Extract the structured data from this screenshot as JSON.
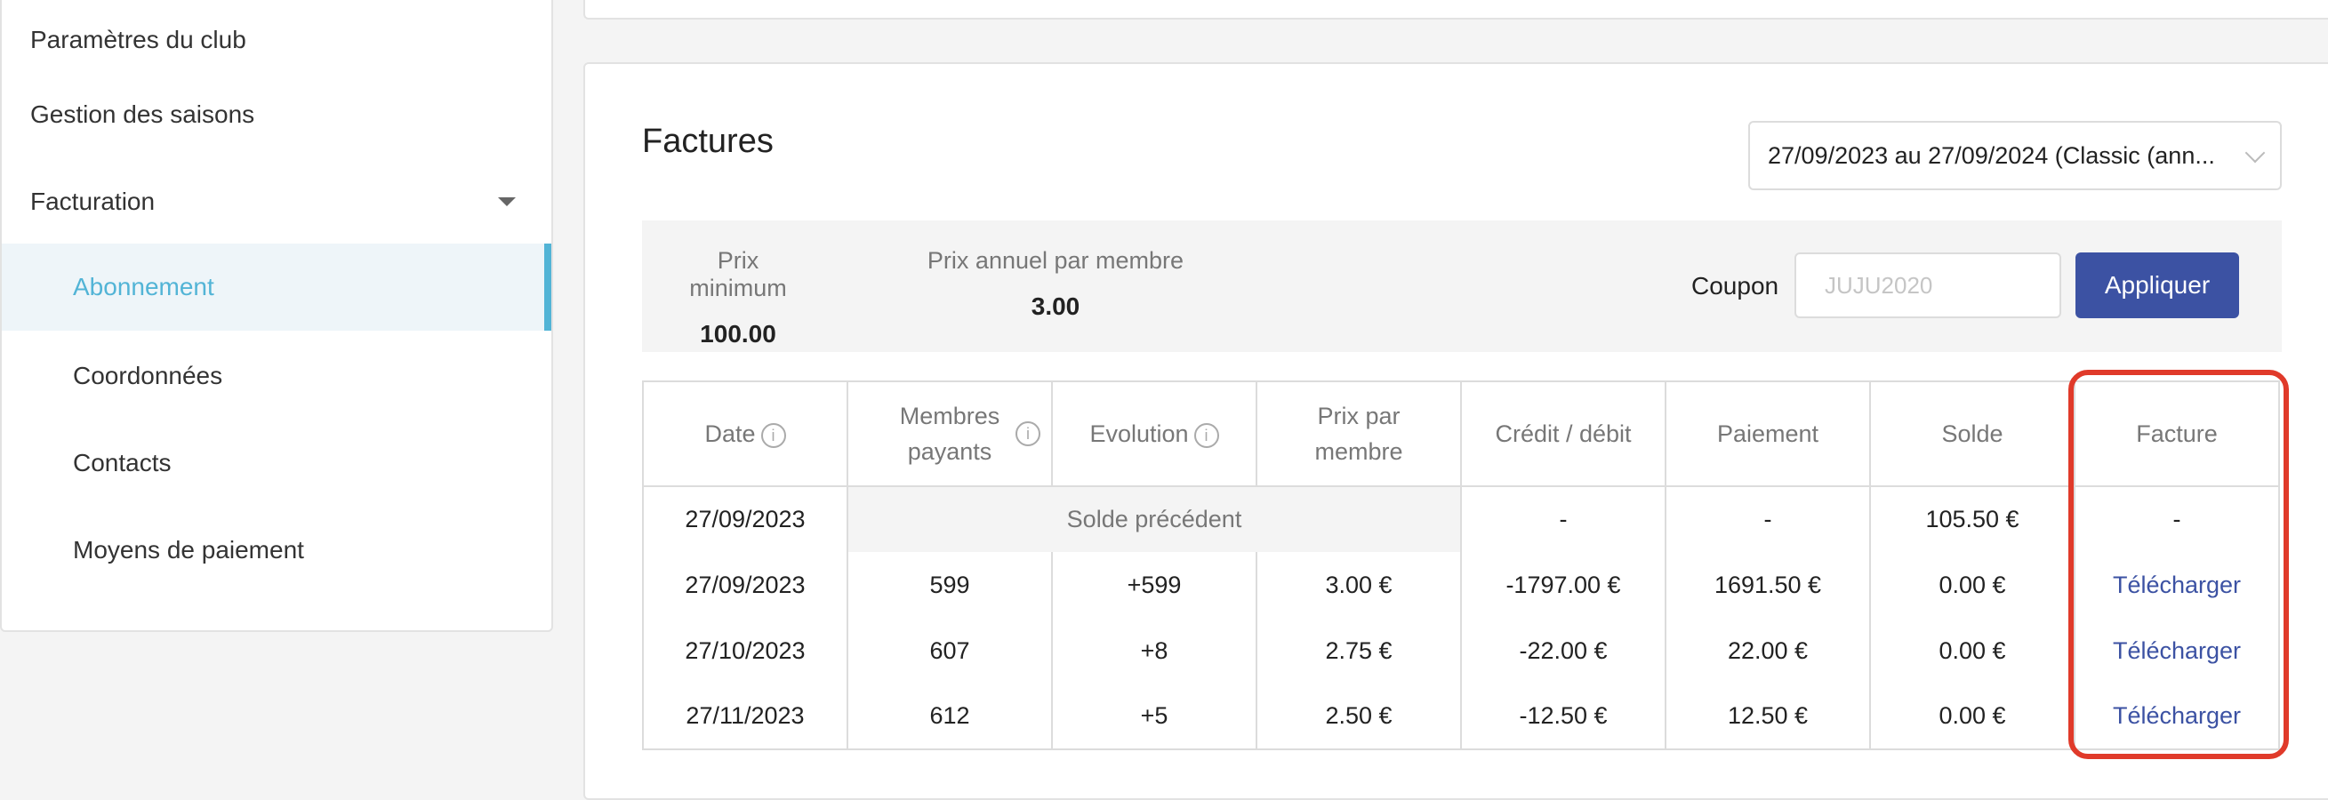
{
  "sidebar": {
    "items": [
      {
        "label": "Paramètres du club"
      },
      {
        "label": "Gestion des saisons"
      },
      {
        "label": "Facturation"
      },
      {
        "label": "Abonnement"
      },
      {
        "label": "Coordonnées"
      },
      {
        "label": "Contacts"
      },
      {
        "label": "Moyens de paiement"
      }
    ]
  },
  "invoices": {
    "title": "Factures",
    "period_select": {
      "value": "27/09/2023 au 27/09/2024 (Classic (ann..."
    },
    "summary": {
      "min_price": {
        "label": "Prix minimum",
        "value": "100.00"
      },
      "annual_price": {
        "label": "Prix annuel par membre",
        "value": "3.00"
      }
    },
    "coupon": {
      "label": "Coupon",
      "placeholder": "JUJU2020",
      "apply_label": "Appliquer"
    },
    "table": {
      "headers": {
        "date": "Date",
        "members_1": "Membres",
        "members_2": "payants",
        "evolution": "Evolution",
        "price_1": "Prix par",
        "price_2": "membre",
        "credit": "Crédit / débit",
        "payment": "Paiement",
        "balance": "Solde",
        "invoice": "Facture"
      },
      "previous_row": {
        "date": "27/09/2023",
        "label": "Solde précédent",
        "credit": "-",
        "payment": "-",
        "balance": "105.50 €",
        "invoice": "-"
      },
      "rows": [
        {
          "date": "27/09/2023",
          "members": "599",
          "evolution": "+599",
          "price": "3.00 €",
          "credit": "-1797.00 €",
          "payment": "1691.50 €",
          "balance": "0.00 €",
          "invoice": "Télécharger"
        },
        {
          "date": "27/10/2023",
          "members": "607",
          "evolution": "+8",
          "price": "2.75 €",
          "credit": "-22.00 €",
          "payment": "22.00 €",
          "balance": "0.00 €",
          "invoice": "Télécharger"
        },
        {
          "date": "27/11/2023",
          "members": "612",
          "evolution": "+5",
          "price": "2.50 €",
          "credit": "-12.50 €",
          "payment": "12.50 €",
          "balance": "0.00 €",
          "invoice": "Télécharger"
        }
      ]
    }
  },
  "colors": {
    "accent": "#52b4d6",
    "primary_button": "#3c52a3",
    "highlight": "#e03a2a"
  },
  "icons": {
    "info": "info-icon",
    "caret": "caret-down-icon",
    "chevron": "chevron-down-icon"
  }
}
